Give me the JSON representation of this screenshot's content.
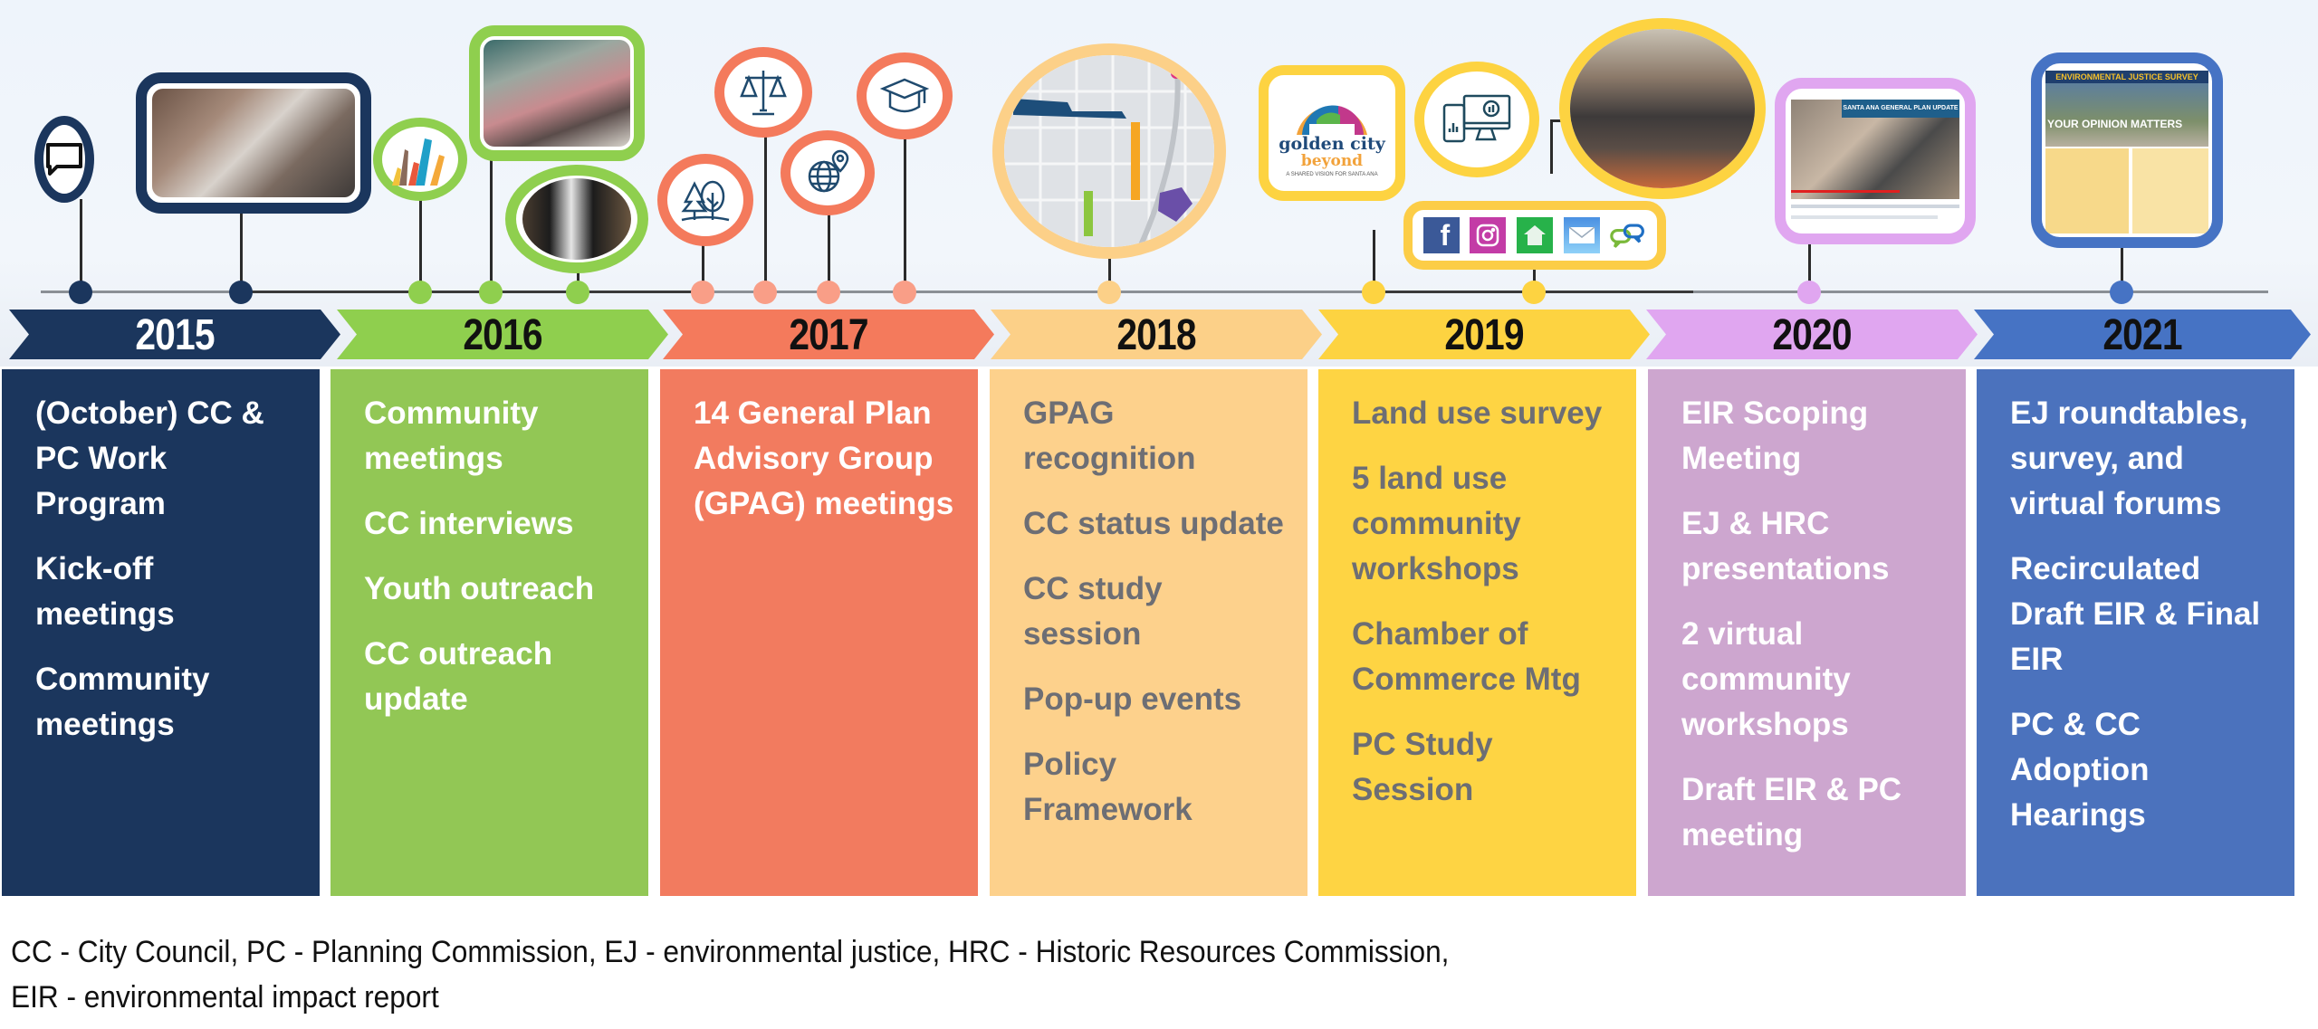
{
  "colors": {
    "y2015": "#1b365d",
    "y2016": "#8fcf4e",
    "y2017": "#f47a5c",
    "y2018": "#fcd088",
    "y2019": "#fdd341",
    "y2020": "#e0a6f0",
    "y2021": "#4673c4"
  },
  "years": [
    {
      "year": "2015",
      "items": [
        "(October) CC & PC Work Program",
        "Kick-off meetings",
        "Community meetings"
      ]
    },
    {
      "year": "2016",
      "items": [
        "Community meetings",
        "CC interviews",
        "Youth outreach",
        "CC outreach update"
      ]
    },
    {
      "year": "2017",
      "items": [
        "14 General Plan Advisory Group (GPAG) meetings"
      ]
    },
    {
      "year": "2018",
      "items": [
        "GPAG recognition",
        "CC status update",
        "CC study session",
        "Pop-up events",
        "Policy Framework"
      ]
    },
    {
      "year": "2019",
      "items": [
        "Land use survey",
        "5 land use community workshops",
        "Chamber of Commerce Mtg",
        "PC Study Session"
      ]
    },
    {
      "year": "2020",
      "items": [
        "EIR Scoping Meeting",
        "EJ & HRC presentations",
        "2 virtual community workshops",
        "Draft EIR & PC meeting"
      ]
    },
    {
      "year": "2021",
      "items": [
        "EJ roundtables, survey, and virtual forums",
        "Recirculated Draft EIR & Final EIR",
        "PC & CC Adoption Hearings"
      ]
    }
  ],
  "milestones": {
    "y2015": [
      "speech-bubble-icon",
      "community-meeting-photo"
    ],
    "y2016": [
      "raised-hands-icon",
      "outreach-booth-photo",
      "display-board-photo"
    ],
    "y2017": [
      "trees-icon",
      "scales-of-justice-icon",
      "globe-pin-icon",
      "graduation-cap-icon"
    ],
    "y2018": [
      "policy-map-image"
    ],
    "y2019": [
      "golden-city-beyond-logo",
      "devices-survey-icon",
      "workshop-audience-photo",
      "social-media-icons"
    ],
    "y2020": [
      "virtual-meeting-video-screenshot"
    ],
    "y2021": [
      "ej-survey-flyer-image"
    ]
  },
  "logo": {
    "line1": "golden city",
    "line2": "beyond",
    "tagline": "A SHARED VISION FOR SANTA ANA"
  },
  "flyer": {
    "header": "ENVIRONMENTAL JUSTICE SURVEY",
    "headline": "YOUR OPINION MATTERS"
  },
  "video": {
    "banner": "SANTA ANA GENERAL PLAN UPDATE"
  },
  "social": [
    "facebook-icon",
    "instagram-icon",
    "nextdoor-icon",
    "email-icon",
    "chat-icon"
  ],
  "footnote": {
    "line1": "CC - City Council, PC - Planning Commission, EJ - environmental justice, HRC - Historic Resources Commission,",
    "line2": "EIR - environmental impact report"
  }
}
